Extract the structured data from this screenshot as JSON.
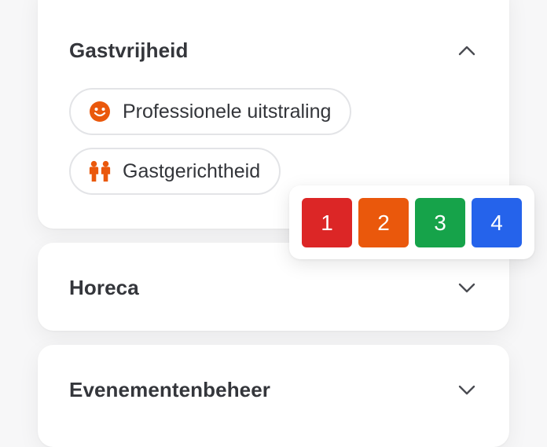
{
  "sections": [
    {
      "title": "Gastvrijheid",
      "expanded": true,
      "chevron_icon": "chevron-up-icon",
      "chips": [
        {
          "label": "Professionele uitstraling",
          "icon": "smiley-face-icon",
          "icon_color": "#ea580c"
        },
        {
          "label": "Gastgerichtheid",
          "icon": "people-icon",
          "icon_color": "#ea580c"
        }
      ]
    },
    {
      "title": "Horeca",
      "expanded": false,
      "chevron_icon": "chevron-down-icon"
    },
    {
      "title": "Evenementenbeheer",
      "expanded": false,
      "chevron_icon": "chevron-down-icon"
    }
  ],
  "rating_popup": {
    "options": [
      {
        "label": "1",
        "color": "#dc2626"
      },
      {
        "label": "2",
        "color": "#ea580c"
      },
      {
        "label": "3",
        "color": "#16a34a"
      },
      {
        "label": "4",
        "color": "#2563eb"
      }
    ]
  },
  "colors": {
    "background": "#f7f7f8",
    "card": "#ffffff",
    "text": "#34363b",
    "chip_border": "#e3e4e7",
    "icon_accent": "#ea580c"
  }
}
